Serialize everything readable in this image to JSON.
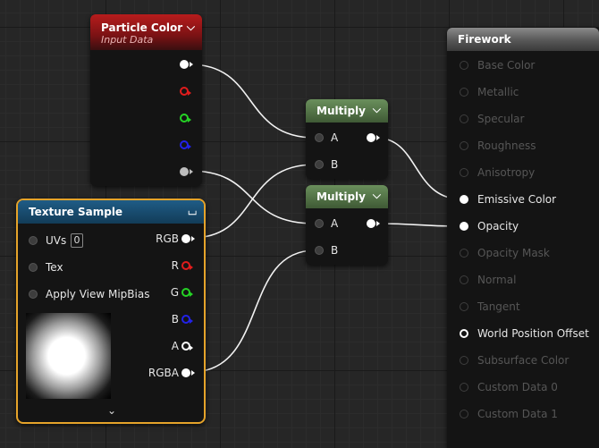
{
  "nodes": {
    "particle_color": {
      "title": "Particle Color",
      "subtitle": "Input Data",
      "collapse_icon": "chevron-down-icon"
    },
    "multiply_1": {
      "title": "Multiply",
      "inputs": [
        "A",
        "B"
      ]
    },
    "multiply_2": {
      "title": "Multiply",
      "inputs": [
        "A",
        "B"
      ]
    },
    "texture_sample": {
      "title": "Texture Sample",
      "inputs": {
        "uvs": "UVs",
        "uvs_value": "0",
        "tex": "Tex",
        "mip": "Apply View MipBias"
      },
      "outputs": [
        "RGB",
        "R",
        "G",
        "B",
        "A",
        "RGBA"
      ],
      "expand_icon": "chevron-down-icon"
    },
    "firework": {
      "title": "Firework",
      "pins": [
        {
          "label": "Base Color",
          "active": false
        },
        {
          "label": "Metallic",
          "active": false
        },
        {
          "label": "Specular",
          "active": false
        },
        {
          "label": "Roughness",
          "active": false
        },
        {
          "label": "Anisotropy",
          "active": false
        },
        {
          "label": "Emissive Color",
          "active": true
        },
        {
          "label": "Opacity",
          "active": true
        },
        {
          "label": "Opacity Mask",
          "active": false
        },
        {
          "label": "Normal",
          "active": false
        },
        {
          "label": "Tangent",
          "active": false
        },
        {
          "label": "World Position Offset",
          "active": true
        },
        {
          "label": "Subsurface Color",
          "active": false
        },
        {
          "label": "Custom Data 0",
          "active": false
        },
        {
          "label": "Custom Data 1",
          "active": false
        }
      ]
    }
  },
  "colors": {
    "selected_outline": "#e5a32a",
    "wire": "#f2f2f2"
  }
}
